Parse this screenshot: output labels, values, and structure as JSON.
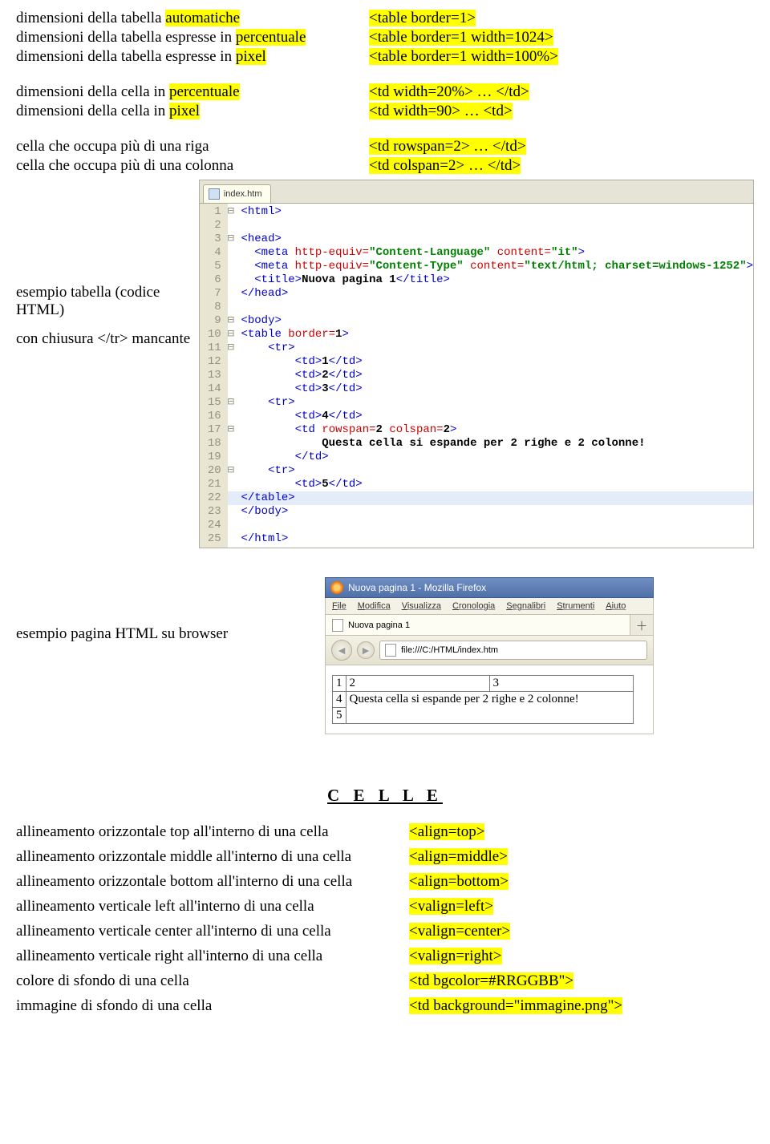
{
  "defs": [
    {
      "l_pre": "dimensioni della tabella ",
      "l_hl": "automatiche",
      "l_post": "",
      "r_hl": "<table border=1>"
    },
    {
      "l_pre": "dimensioni della tabella espresse in ",
      "l_hl": "percentuale",
      "l_post": "",
      "r_hl": "<table border=1 width=1024>"
    },
    {
      "l_pre": "dimensioni della tabella espresse in ",
      "l_hl": "pixel",
      "l_post": "",
      "r_hl": "<table border=1 width=100%>"
    }
  ],
  "defs2": [
    {
      "l_pre": "dimensioni della cella in ",
      "l_hl": "percentuale",
      "l_post": "",
      "r_hl": "<td width=20%> … </td>"
    },
    {
      "l_pre": "dimensioni della cella in ",
      "l_hl": "pixel",
      "l_post": "",
      "r_hl": "<td width=90> … <td>"
    }
  ],
  "defs3": [
    {
      "l": "cella che occupa più di una riga",
      "r_hl": "<td rowspan=2> … </td>"
    },
    {
      "l": "cella che occupa più di una colonna",
      "r_hl": "<td colspan=2> … </td>"
    }
  ],
  "captions": {
    "ex_code": "esempio tabella (codice HTML)",
    "ex_code2": "con chiusura </tr> mancante",
    "ex_browser": "esempio pagina HTML su browser"
  },
  "editor": {
    "tab": "index.htm",
    "lines": [
      {
        "n": 1,
        "fold": "⊟",
        "html": "<span class='tagc'>&lt;html&gt;</span>"
      },
      {
        "n": 2,
        "fold": " ",
        "html": ""
      },
      {
        "n": 3,
        "fold": "⊟",
        "html": "<span class='tagc'>&lt;head&gt;</span>"
      },
      {
        "n": 4,
        "fold": " ",
        "html": "  <span class='tagc'>&lt;meta</span> <span class='attrn'>http-equiv=</span><span class='attrv'>\"Content-Language\"</span> <span class='attrn'>content=</span><span class='attrv'>\"it\"</span><span class='tagc'>&gt;</span>"
      },
      {
        "n": 5,
        "fold": " ",
        "html": "  <span class='tagc'>&lt;meta</span> <span class='attrn'>http-equiv=</span><span class='attrv'>\"Content-Type\"</span> <span class='attrn'>content=</span><span class='attrv'>\"text/html; charset=windows-1252\"</span><span class='tagc'>&gt;</span>"
      },
      {
        "n": 6,
        "fold": " ",
        "html": "  <span class='tagc'>&lt;title&gt;</span><span class='txtc'>Nuova pagina 1</span><span class='tagc'>&lt;/title&gt;</span>"
      },
      {
        "n": 7,
        "fold": " ",
        "html": "<span class='tagc'>&lt;/head&gt;</span>"
      },
      {
        "n": 8,
        "fold": " ",
        "html": ""
      },
      {
        "n": 9,
        "fold": "⊟",
        "html": "<span class='tagc'>&lt;body&gt;</span>"
      },
      {
        "n": 10,
        "fold": "⊟",
        "html": "<span class='tagc'>&lt;table</span> <span class='attrn'>border=</span><span class='txtc'>1</span><span class='tagc'>&gt;</span>"
      },
      {
        "n": 11,
        "fold": "⊟",
        "html": "    <span class='tagc'>&lt;tr&gt;</span>"
      },
      {
        "n": 12,
        "fold": " ",
        "html": "        <span class='tagc'>&lt;td&gt;</span><span class='txtc'>1</span><span class='tagc'>&lt;/td&gt;</span>"
      },
      {
        "n": 13,
        "fold": " ",
        "html": "        <span class='tagc'>&lt;td&gt;</span><span class='txtc'>2</span><span class='tagc'>&lt;/td&gt;</span>"
      },
      {
        "n": 14,
        "fold": " ",
        "html": "        <span class='tagc'>&lt;td&gt;</span><span class='txtc'>3</span><span class='tagc'>&lt;/td&gt;</span>"
      },
      {
        "n": 15,
        "fold": "⊟",
        "html": "    <span class='tagc'>&lt;tr&gt;</span>"
      },
      {
        "n": 16,
        "fold": " ",
        "html": "        <span class='tagc'>&lt;td&gt;</span><span class='txtc'>4</span><span class='tagc'>&lt;/td&gt;</span>"
      },
      {
        "n": 17,
        "fold": "⊟",
        "html": "        <span class='tagc'>&lt;td</span> <span class='attrn'>rowspan=</span><span class='txtc'>2</span> <span class='attrn'>colspan=</span><span class='txtc'>2</span><span class='tagc'>&gt;</span>"
      },
      {
        "n": 18,
        "fold": " ",
        "html": "            <span class='txtc'>Questa cella si espande per 2 righe e 2 colonne!</span>"
      },
      {
        "n": 19,
        "fold": " ",
        "html": "        <span class='tagc'>&lt;/td&gt;</span>"
      },
      {
        "n": 20,
        "fold": "⊟",
        "html": "    <span class='tagc'>&lt;tr&gt;</span>"
      },
      {
        "n": 21,
        "fold": " ",
        "html": "        <span class='tagc'>&lt;td&gt;</span><span class='txtc'>5</span><span class='tagc'>&lt;/td&gt;</span>"
      },
      {
        "n": 22,
        "fold": " ",
        "html": "<span class='tagc'>&lt;/table&gt;</span>",
        "hl": true
      },
      {
        "n": 23,
        "fold": " ",
        "html": "<span class='tagc'>&lt;/body&gt;</span>"
      },
      {
        "n": 24,
        "fold": " ",
        "html": ""
      },
      {
        "n": 25,
        "fold": " ",
        "html": "<span class='tagc'>&lt;/html&gt;</span>"
      }
    ]
  },
  "firefox": {
    "title": "Nuova pagina 1 - Mozilla Firefox",
    "menus": [
      "File",
      "Modifica",
      "Visualizza",
      "Cronologia",
      "Segnalibri",
      "Strumenti",
      "Aiuto"
    ],
    "tab": "Nuova pagina 1",
    "url": "file:///C:/HTML/index.htm",
    "table": {
      "r1": [
        "1",
        "2",
        "3"
      ],
      "r2": [
        "4",
        "Questa cella si espande per 2 righe e 2 colonne!"
      ],
      "r3": [
        "5"
      ]
    }
  },
  "section": "C E L L E",
  "cells": [
    {
      "l": "allineamento orizzontale top all'interno di una cella",
      "r": "<align=top>"
    },
    {
      "l": "allineamento orizzontale middle all'interno di una cella",
      "r": "<align=middle>"
    },
    {
      "l": "allineamento orizzontale bottom all'interno di una cella",
      "r": "<align=bottom>"
    },
    {
      "l": "allineamento verticale left all'interno di una cella",
      "r": "<valign=left>"
    },
    {
      "l": "allineamento verticale center all'interno di una cella",
      "r": "<valign=center>"
    },
    {
      "l": "allineamento verticale right all'interno di una cella",
      "r": "<valign=right>"
    },
    {
      "l": "colore di sfondo di una cella",
      "r": "<td bgcolor=#RRGGBB\">"
    },
    {
      "l": "immagine di sfondo di una cella",
      "r": "<td background=\"immagine.png\">"
    }
  ]
}
